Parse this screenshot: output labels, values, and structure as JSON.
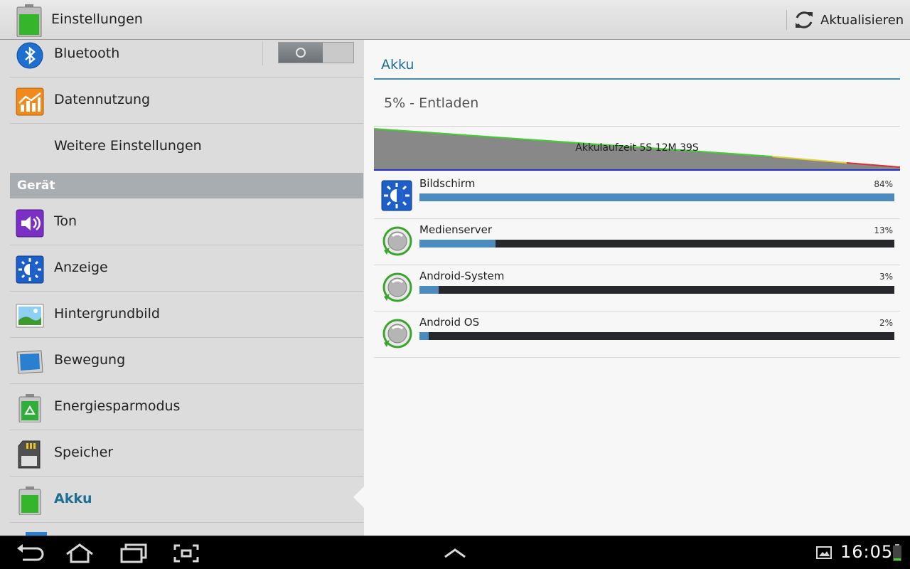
{
  "header": {
    "title": "Einstellungen",
    "refresh_label": "Aktualisieren"
  },
  "sidebar": {
    "section_label": "Gerät",
    "items": [
      {
        "label": "Bluetooth",
        "icon": "bluetooth-icon",
        "toggle": "off"
      },
      {
        "label": "Datennutzung",
        "icon": "data-usage-icon"
      },
      {
        "label": "Weitere Einstellungen",
        "icon": ""
      },
      {
        "label": "Ton",
        "icon": "speaker-icon"
      },
      {
        "label": "Anzeige",
        "icon": "brightness-icon"
      },
      {
        "label": "Hintergrundbild",
        "icon": "wallpaper-icon"
      },
      {
        "label": "Bewegung",
        "icon": "motion-icon"
      },
      {
        "label": "Energiesparmodus",
        "icon": "power-saving-icon"
      },
      {
        "label": "Speicher",
        "icon": "sd-card-icon"
      },
      {
        "label": "Akku",
        "icon": "battery-icon",
        "active": true
      }
    ]
  },
  "battery": {
    "title": "Akku",
    "status": "5% - Entladen",
    "graph_label": "Akkulaufzeit 5S 12M 39S",
    "apps": [
      {
        "name": "Bildschirm",
        "percent_label": "84%",
        "fraction": 1.0,
        "icon": "brightness-icon"
      },
      {
        "name": "Medienserver",
        "percent_label": "13%",
        "fraction": 0.16,
        "icon": "android-app-icon"
      },
      {
        "name": "Android-System",
        "percent_label": "3%",
        "fraction": 0.04,
        "icon": "android-app-icon"
      },
      {
        "name": "Android OS",
        "percent_label": "2%",
        "fraction": 0.02,
        "icon": "android-app-icon"
      }
    ]
  },
  "statusbar": {
    "time": "16:05"
  },
  "colors": {
    "accent": "#1c6e94",
    "bar_fill": "#4b8bbe",
    "bar_track": "#26282c"
  }
}
